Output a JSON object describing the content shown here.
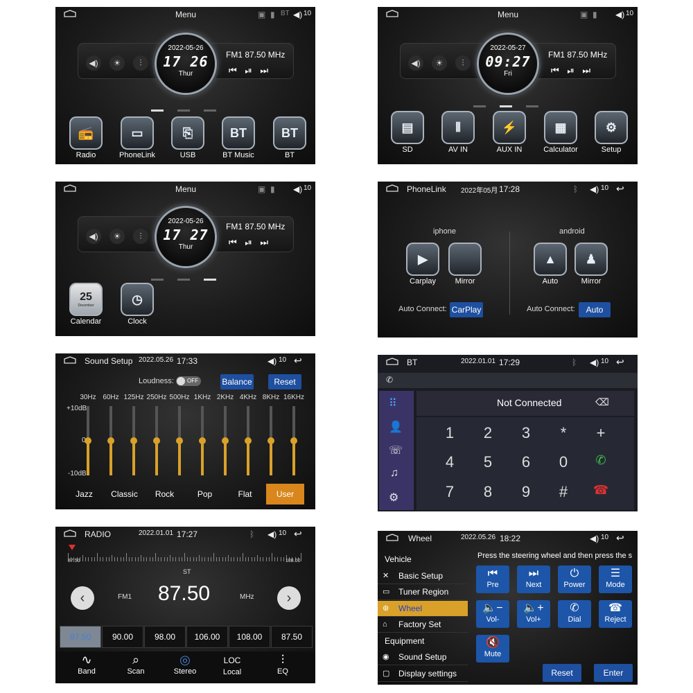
{
  "s1": {
    "title": "Menu",
    "bt": "BT",
    "volume": "10",
    "date": "2022-05-26",
    "time": "17 26",
    "weekday": "Thur",
    "radio": "FM1 87.50 MHz",
    "apps": [
      "Radio",
      "PhoneLink",
      "USB",
      "BT Music",
      "BT"
    ],
    "app_glyphs": [
      "📻",
      "▭",
      "⎘",
      "BT",
      "BT"
    ]
  },
  "s2": {
    "title": "Menu",
    "volume": "10",
    "date": "2022-05-27",
    "time": "09:27",
    "weekday": "Fri",
    "radio": "FM1 87.50 MHz",
    "apps": [
      "SD",
      "AV IN",
      "AUX IN",
      "Calculator",
      "Setup"
    ],
    "app_glyphs": [
      "▤",
      "⫴",
      "⚡",
      "▦",
      "⚙"
    ]
  },
  "s3": {
    "title": "Menu",
    "volume": "10",
    "date": "2022-05-26",
    "time": "17 27",
    "weekday": "Thur",
    "radio": "FM1 87.50 MHz",
    "apps": [
      "Calendar",
      "Clock"
    ],
    "cal_day": "25",
    "cal_month": "December"
  },
  "s4": {
    "title": "PhoneLink",
    "date": "2022年05月",
    "time": "17:28",
    "volume": "10",
    "iphone_label": "iphone",
    "android_label": "android",
    "iphone_apps": [
      "Carplay",
      "Mirror"
    ],
    "android_apps": [
      "Auto",
      "Mirror"
    ],
    "auto_connect_label": "Auto Connect:",
    "iphone_connect": "CarPlay",
    "android_connect": "Auto"
  },
  "s5": {
    "title": "Sound Setup",
    "date": "2022.05.26",
    "time": "17:33",
    "volume": "10",
    "loudness_label": "Loudness:",
    "loudness_state": "OFF",
    "balance": "Balance",
    "reset": "Reset",
    "freqs": [
      "30Hz",
      "60Hz",
      "125Hz",
      "250Hz",
      "500Hz",
      "1KHz",
      "2KHz",
      "4KHz",
      "8KHz",
      "16KHz"
    ],
    "db_top": "+10dB",
    "db_mid": "0",
    "db_bot": "-10dB",
    "presets": [
      "Jazz",
      "Classic",
      "Rock",
      "Pop",
      "Flat",
      "User"
    ],
    "active_preset": "User"
  },
  "s6": {
    "title": "BT",
    "date": "2022.01.01",
    "time": "17:29",
    "volume": "10",
    "status": "Not Connected",
    "keys": [
      "1",
      "2",
      "3",
      "*",
      "+",
      "4",
      "5",
      "6",
      "0",
      "7",
      "8",
      "9",
      "#"
    ]
  },
  "s7": {
    "title": "RADIO",
    "date": "2022.01.01",
    "time": "17:27",
    "volume": "10",
    "scale_min": "87.50",
    "scale_max": "108.00",
    "stereo": "ST",
    "band": "FM1",
    "freq": "87.50",
    "unit": "MHz",
    "presets": [
      "87.50",
      "90.00",
      "98.00",
      "106.00",
      "108.00",
      "87.50"
    ],
    "tabs": [
      "Band",
      "Scan",
      "Stereo",
      "Local",
      "EQ"
    ]
  },
  "s8": {
    "title": "Wheel",
    "date": "2022.05.26",
    "time": "18:22",
    "volume": "10",
    "instruction": "Press the steering wheel and then press the s",
    "menu": [
      "Vehicle",
      "Basic Setup",
      "Tuner Region",
      "Wheel",
      "Factory Set",
      "Equipment",
      "Sound Setup",
      "Display settings"
    ],
    "buttons": [
      "Pre",
      "Next",
      "Power",
      "Mode",
      "Vol-",
      "Vol+",
      "Dial",
      "Reject",
      "Mute"
    ],
    "glyphs": [
      "⏮",
      "⏭",
      "⏻",
      "☰",
      "🔈−",
      "🔈+",
      "✆",
      "☎",
      "🔇"
    ],
    "reset": "Reset",
    "enter": "Enter"
  }
}
